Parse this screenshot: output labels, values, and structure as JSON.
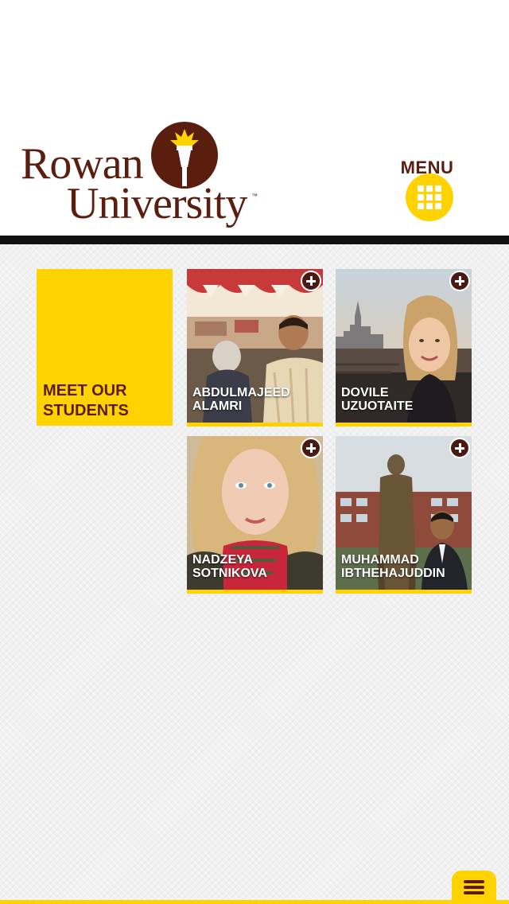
{
  "brand": {
    "line1": "Rowan",
    "line2": "University",
    "trademark": "™",
    "color": "#5a1e0f",
    "accent": "#ffd200"
  },
  "menu": {
    "label": "MENU",
    "icon": "grid-icon"
  },
  "intro": {
    "title_line1": "MEET OUR",
    "title_line2": "STUDENTS"
  },
  "students": [
    {
      "name_line1": "ABDULMAJEED",
      "name_line2": "ALAMRI",
      "action_icon": "plus-icon"
    },
    {
      "name_line1": "DOVILE",
      "name_line2": "UZUOTAITE",
      "action_icon": "plus-icon"
    },
    {
      "name_line1": "NADZEYA",
      "name_line2": "SOTNIKOVA",
      "action_icon": "plus-icon"
    },
    {
      "name_line1": "MUHAMMAD",
      "name_line2": "IBTHEHAJUDDIN",
      "action_icon": "plus-icon"
    }
  ],
  "footer": {
    "icon": "hamburger-icon"
  }
}
